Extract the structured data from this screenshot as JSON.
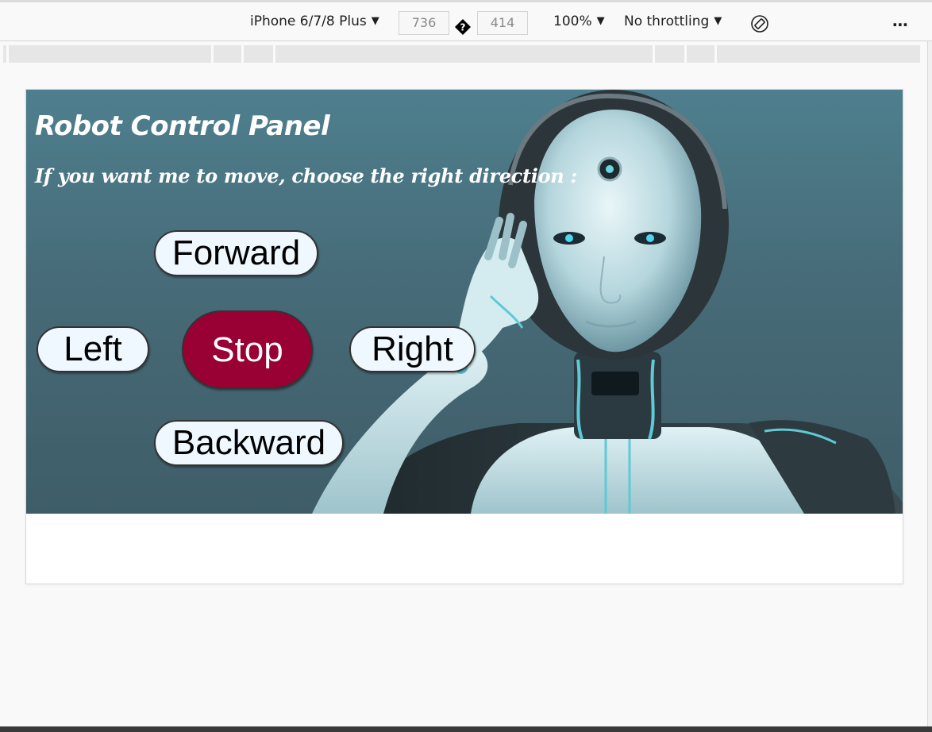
{
  "devtools": {
    "device": "iPhone 6/7/8 Plus",
    "width": "736",
    "height": "414",
    "zoom": "100%",
    "throttling": "No throttling",
    "dim_separator": "�"
  },
  "page": {
    "title": "Robot Control Panel",
    "subtitle": "If you want me to move, choose the right direction :",
    "buttons": {
      "forward": "Forward",
      "left": "Left",
      "stop": "Stop",
      "right": "Right",
      "backward": "Backward"
    }
  },
  "colors": {
    "stop_button": "#990033",
    "direction_button": "#f0f8ff",
    "hero_background": "#4e7f8e"
  },
  "icons": [
    "dropdown-arrow-icon",
    "rotate-icon",
    "more-options-icon",
    "robot-image"
  ]
}
